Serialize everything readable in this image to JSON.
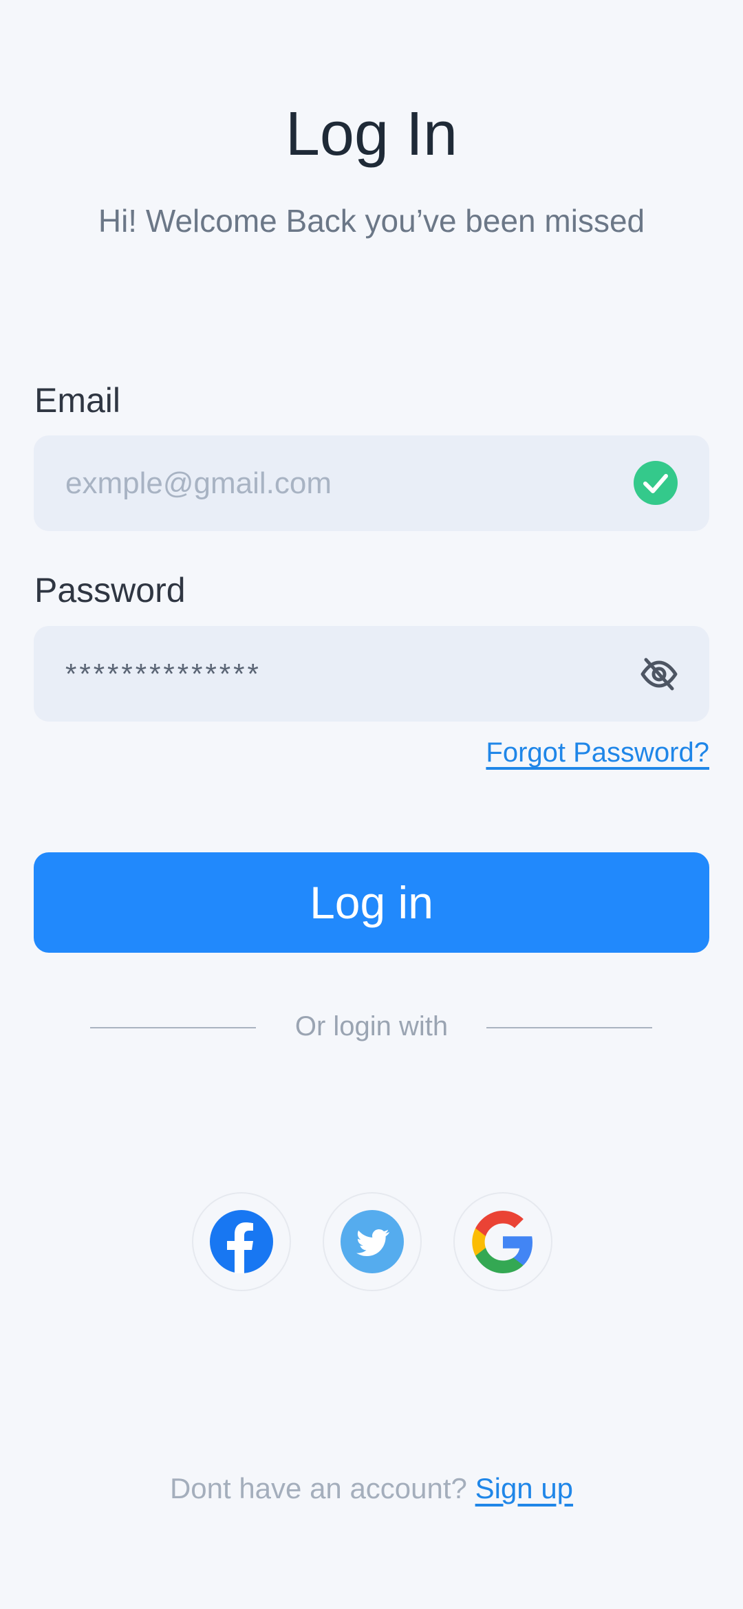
{
  "header": {
    "title": "Log In",
    "subtitle": "Hi! Welcome Back you’ve been missed"
  },
  "form": {
    "email_label": "Email",
    "email_placeholder": "exmple@gmail.com",
    "email_valid_icon": "check-circle-icon",
    "password_label": "Password",
    "password_value": "**************",
    "password_visibility_icon": "eye-off-icon",
    "forgot_password": "Forgot Password?",
    "submit_label": "Log in"
  },
  "social": {
    "divider_text": "Or login with",
    "providers": [
      {
        "name": "Facebook",
        "icon": "facebook-icon"
      },
      {
        "name": "Twitter",
        "icon": "twitter-icon"
      },
      {
        "name": "Google",
        "icon": "google-icon"
      }
    ]
  },
  "footer": {
    "text": "Dont have an account?",
    "link": "Sign up"
  },
  "colors": {
    "accent": "#2189FC",
    "success": "#34C98B",
    "background": "#F5F7FB",
    "field_background": "#E9EEF7"
  }
}
